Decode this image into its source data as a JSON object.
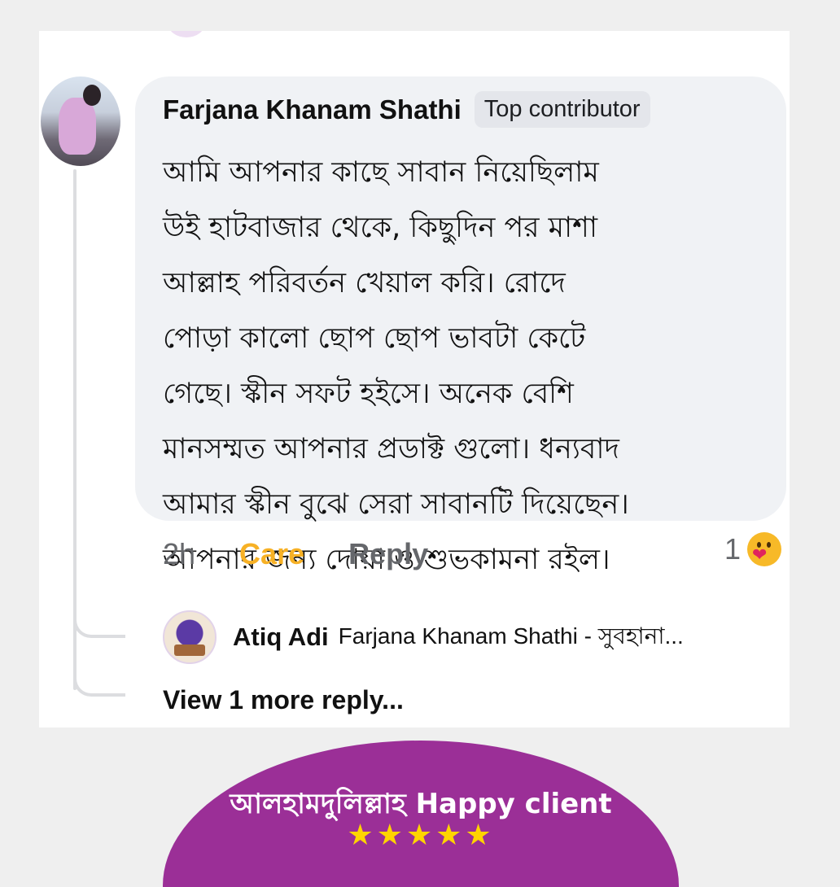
{
  "comment": {
    "author_name": "Farjana Khanam Shathi",
    "badge": "Top contributor",
    "text_lines": [
      "আমি আপনার কাছে সাবান নিয়েছিলাম",
      "উই হাটবাজার থেকে, কিছুদিন পর মাশা",
      "আল্লাহ পরিবর্তন খেয়াল করি।  রোদে",
      "পোড়া কালো ছোপ ছোপ ভাবটা কেটে",
      "গেছে। স্কীন সফট হইসে। অনেক বেশি",
      "মানসম্মত আপনার প্রডাক্ট গুলো। ধন্যবাদ",
      "আমার স্কীন বুঝে সেরা সাবানটি দিয়েছেন।",
      "আপনার জন্য দোয়া ও শুভকামনা রইল।"
    ],
    "time": "2h",
    "reaction_label": "Care",
    "reply_label": "Reply",
    "reaction_count": "1",
    "reaction_icon": "care-emoji"
  },
  "reply_preview": {
    "author": "Atiq Adi",
    "text": "Farjana Khanam Shathi - সুবহানা..."
  },
  "view_more": "View 1 more reply...",
  "banner": {
    "text": "আলহামদুলিল্লাহ Happy client",
    "stars": "★★★★★",
    "stars_count": 5,
    "color": "#9b2f97",
    "star_color": "#ffd400"
  },
  "colors": {
    "care_text": "#f7b125",
    "muted": "#65676b",
    "bubble": "#f0f2f5"
  }
}
